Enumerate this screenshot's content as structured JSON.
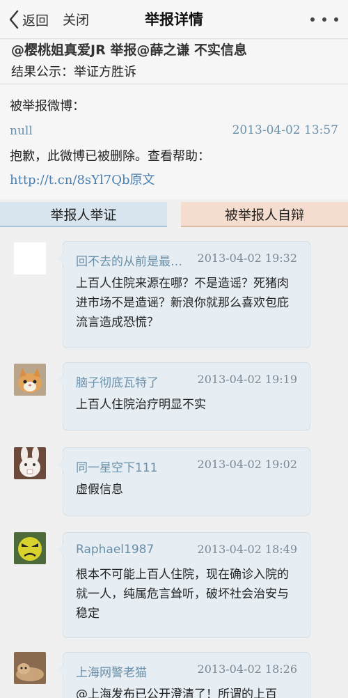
{
  "navbar": {
    "back_label": "返回",
    "close_label": "关闭",
    "title": "举报详情"
  },
  "report": {
    "summary": "@樱桃姐真爱JR 举报@薛之谦 不实信息",
    "result": "结果公示：举证方胜诉"
  },
  "reported_weibo": {
    "section_label": "被举报微博：",
    "user": "null",
    "time": "2013-04-02 13:57",
    "text": "抱歉，此微博已被删除。查看帮助：",
    "link": "http://t.cn/8sYl7Qb原文"
  },
  "tabs": [
    {
      "label": "举报人举证"
    },
    {
      "label": "被举报人自辩"
    }
  ],
  "comments": [
    {
      "name": "回不去的从前是最…",
      "time": "2013-04-02 19:32",
      "text": "上百人住院来源在哪？不是造谣？死猪肉进市场不是造谣？新浪你就那么喜欢包庇流言造成恐慌？",
      "avatar": "blank-avatar"
    },
    {
      "name": "脑子彻底瓦特了",
      "time": "2013-04-02 19:19",
      "text": "上百人住院治疗明显不实",
      "avatar": "cat-avatar"
    },
    {
      "name": "同一星空下111",
      "time": "2013-04-02 19:02",
      "text": "虚假信息",
      "avatar": "rabbit-avatar"
    },
    {
      "name": "Raphael1987",
      "time": "2013-04-02 18:49",
      "text": "根本不可能上百人住院，现在确诊入院的就一人，纯属危言耸听，破坏社会治安与稳定",
      "avatar": "angry-face-avatar"
    },
    {
      "name": "上海网警老猫",
      "time": "2013-04-02 18:26",
      "text": "@上海发布已公开澄清了！所谓的上百",
      "avatar": "cat-lying-avatar"
    }
  ]
}
